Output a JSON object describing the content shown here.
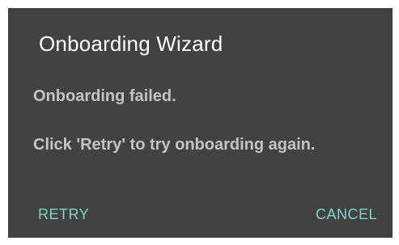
{
  "dialog": {
    "title": "Onboarding Wizard",
    "message_primary": "Onboarding failed.",
    "message_secondary": "Click 'Retry' to try onboarding again.",
    "buttons": {
      "retry_label": "RETRY",
      "cancel_label": "CANCEL"
    }
  },
  "colors": {
    "dialog_background": "#424242",
    "title_text": "#ffffff",
    "body_text": "#c4c4c4",
    "accent": "#7ed3c4",
    "page_background": "#ffffff"
  }
}
